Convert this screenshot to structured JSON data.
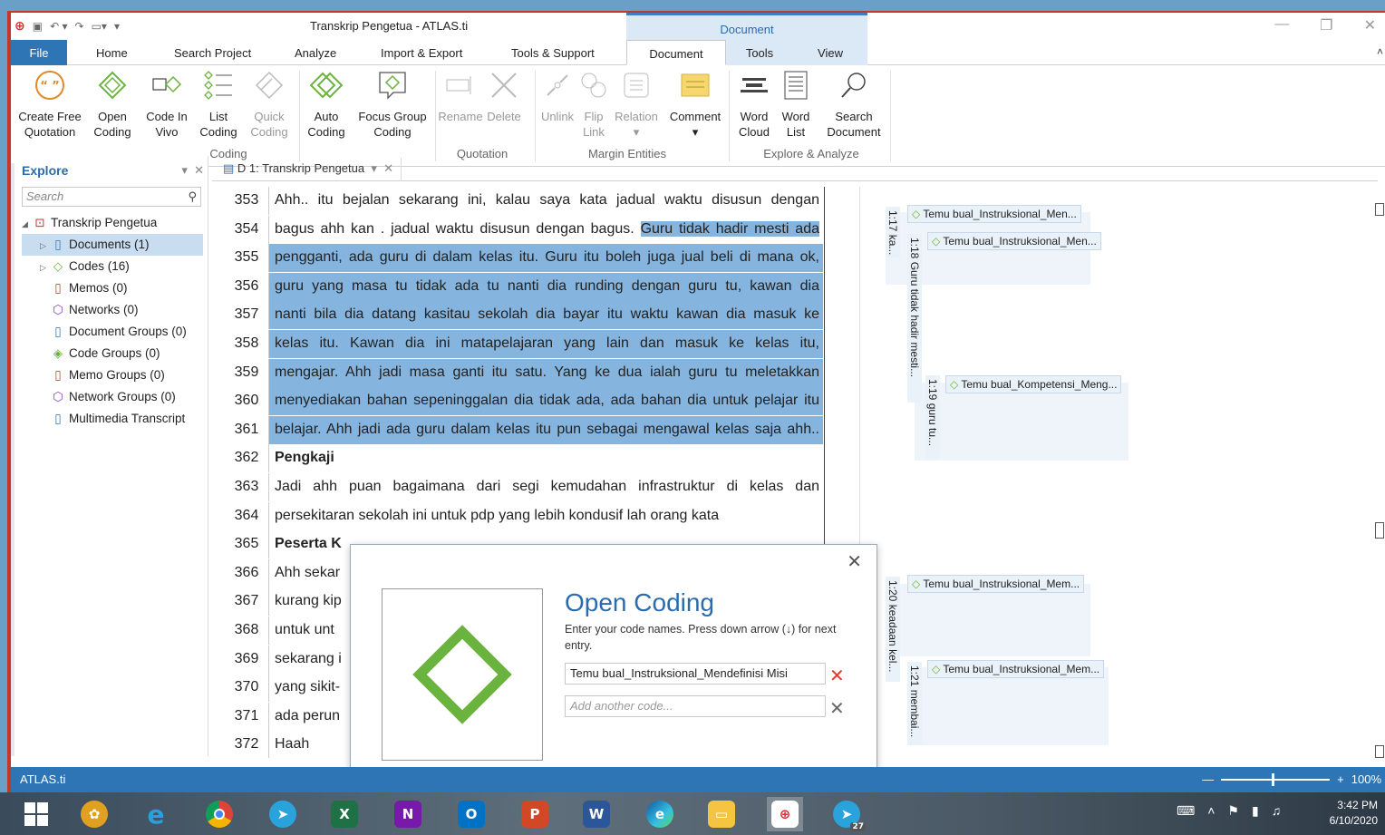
{
  "window": {
    "title": "Transkrip Pengetua - ATLAS.ti",
    "context_tab_group": "Document"
  },
  "tabs": [
    "File",
    "Home",
    "Search Project",
    "Analyze",
    "Import & Export",
    "Tools & Support",
    "Document",
    "Tools",
    "View"
  ],
  "ribbon": {
    "buttons": [
      {
        "line1": "Create Free",
        "line2": "Quotation"
      },
      {
        "line1": "Open",
        "line2": "Coding"
      },
      {
        "line1": "Code In",
        "line2": "Vivo"
      },
      {
        "line1": "List",
        "line2": "Coding"
      },
      {
        "line1": "Quick",
        "line2": "Coding"
      },
      {
        "line1": "Auto",
        "line2": "Coding"
      },
      {
        "line1": "Focus Group",
        "line2": "Coding"
      },
      {
        "line1": "Rename",
        "line2": ""
      },
      {
        "line1": "Delete",
        "line2": ""
      },
      {
        "line1": "Unlink",
        "line2": ""
      },
      {
        "line1": "Flip",
        "line2": "Link"
      },
      {
        "line1": "Relation",
        "line2": "▾"
      },
      {
        "line1": "Comment",
        "line2": "▾"
      },
      {
        "line1": "Word",
        "line2": "Cloud"
      },
      {
        "line1": "Word",
        "line2": "List"
      },
      {
        "line1": "Search",
        "line2": "Document"
      }
    ],
    "groups": [
      "Coding",
      "Quotation",
      "Margin Entities",
      "Explore & Analyze"
    ]
  },
  "explore": {
    "title": "Explore",
    "search_placeholder": "Search",
    "root": "Transkrip Pengetua",
    "items": [
      "Documents (1)",
      "Codes (16)",
      "Memos (0)",
      "Networks (0)",
      "Document Groups (0)",
      "Code Groups (0)",
      "Memo Groups (0)",
      "Network Groups (0)",
      "Multimedia Transcript"
    ]
  },
  "doc_tab": "D 1: Transkrip Pengetua",
  "document_lines": [
    {
      "no": "353",
      "text": "Ahh.. itu bejalan sekarang ini, kalau saya kata jadual waktu disusun dengan",
      "hl": false
    },
    {
      "no": "354",
      "text_a": "bagus ahh kan . jadual waktu disusun dengan bagus. ",
      "text_b": "Guru tidak hadir mesti ada",
      "hl": "partial"
    },
    {
      "no": "355",
      "text": "pengganti, ada guru di dalam kelas itu. Guru itu boleh juga jual beli di mana ok,",
      "hl": true
    },
    {
      "no": "356",
      "text": "guru yang masa tu tidak ada tu nanti dia runding dengan guru tu, kawan dia",
      "hl": true
    },
    {
      "no": "357",
      "text": "nanti bila dia datang kasitau sekolah dia bayar itu waktu kawan dia masuk ke",
      "hl": true
    },
    {
      "no": "358",
      "text": "kelas itu. Kawan dia ini matapelajaran yang lain dan masuk ke kelas itu,",
      "hl": true
    },
    {
      "no": "359",
      "text": "mengajar. Ahh jadi masa ganti itu satu. Yang ke dua ialah guru tu meletakkan",
      "hl": true
    },
    {
      "no": "360",
      "text": "menyediakan bahan sepeninggalan dia tidak ada, ada bahan dia untuk pelajar itu",
      "hl": true
    },
    {
      "no": "361",
      "text": "belajar. Ahh jadi ada guru dalam kelas itu pun sebagai mengawal kelas saja ahh..",
      "hl": true
    },
    {
      "no": "362",
      "text": "Pengkaji",
      "bold": true
    },
    {
      "no": "363",
      "text": "Jadi ahh puan bagaimana dari segi kemudahan infrastruktur di kelas dan",
      "hl": false
    },
    {
      "no": "364",
      "text": "persekitaran sekolah ini untuk pdp yang lebih kondusif lah orang kata",
      "hl": false,
      "left": true
    },
    {
      "no": "365",
      "text": "Peserta K",
      "bold": true
    },
    {
      "no": "366",
      "text": "Ahh sekar",
      "hl": false,
      "left": true
    },
    {
      "no": "367",
      "text": "kurang kip",
      "hl": false,
      "left": true
    },
    {
      "no": "368",
      "text": "untuk unt",
      "hl": false,
      "left": true
    },
    {
      "no": "369",
      "text": "sekarang i",
      "hl": false,
      "left": true
    },
    {
      "no": "370",
      "text": "yang sikit-",
      "hl": false,
      "left": true
    },
    {
      "no": "371",
      "text": "ada perun",
      "hl": false,
      "left": true
    },
    {
      "no": "372",
      "text": "Haah",
      "hl": false,
      "left": true
    }
  ],
  "margin": {
    "quotations": [
      "1:17 ka...",
      "1:18 Guru tidak hadir mesti...",
      "1:19 guru tu...",
      "1:20 keadaan kel...",
      "1:21 membai..."
    ],
    "codes": [
      "Temu bual_Instruksional_Men...",
      "Temu bual_Instruksional_Men...",
      "Temu bual_Kompetensi_Meng...",
      "Temu bual_Instruksional_Mem...",
      "Temu bual_Instruksional_Mem..."
    ]
  },
  "dialog": {
    "title": "Open Coding",
    "instructions": "Enter your code names. Press down arrow (↓) for next entry.",
    "code_value": "Temu bual_Instruksional_Mendefinisi Misi",
    "add_placeholder": "Add another code..."
  },
  "status": {
    "app": "ATLAS.ti",
    "zoom": "100%"
  },
  "taskbar": {
    "time": "3:42 PM",
    "date": "6/10/2020",
    "badge": "27"
  },
  "colors": {
    "accent": "#2e75b6",
    "highlight": "#85b4de",
    "code_green": "#6bb33f"
  }
}
